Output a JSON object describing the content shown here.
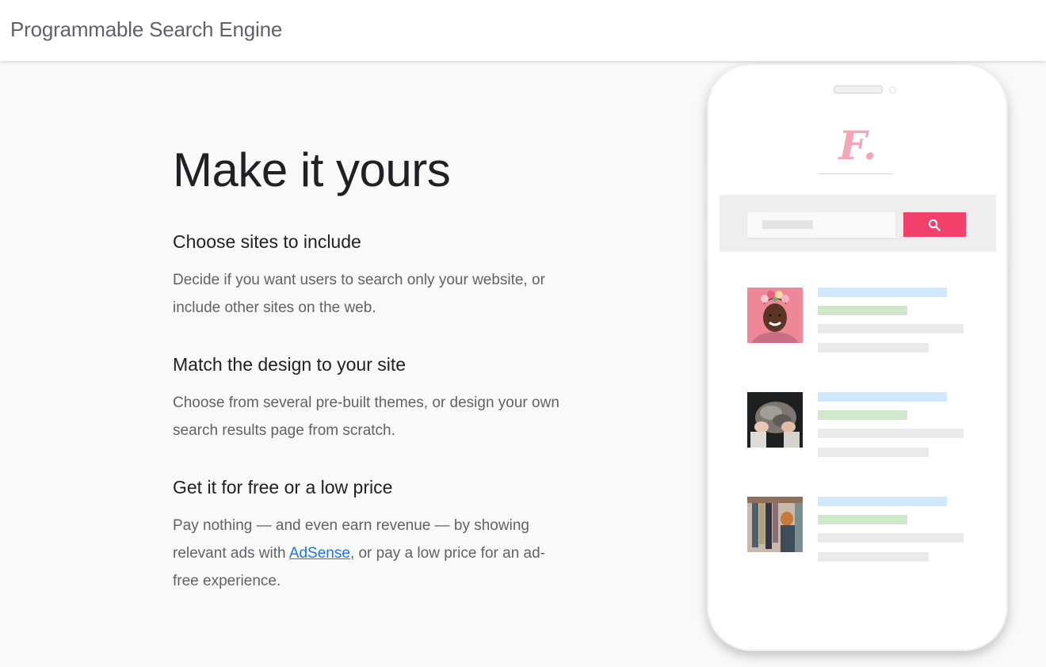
{
  "header": {
    "title": "Programmable Search Engine"
  },
  "main": {
    "headline": "Make it yours",
    "sections": [
      {
        "title": "Choose sites to include",
        "text": "Decide if you want users to search only your website, or include other sites on the web."
      },
      {
        "title": "Match the design to your site",
        "text": "Choose from several pre-built themes, or design your own search results page from scratch."
      },
      {
        "title": "Get it for free or a low price",
        "text_before_link": "Pay nothing — and even earn revenue — by showing relevant ads with ",
        "link_label": "AdSense",
        "text_after_link": ", or pay a low price for an ad-free experience."
      }
    ]
  },
  "phone": {
    "logo_text": "F.",
    "icons": {
      "search": "search-icon"
    },
    "colors": {
      "search_button": "#f2416b",
      "logo": "#f4a6b7",
      "result_title_bar": "#d2e8fb",
      "result_url_bar": "#d1e7cc",
      "result_text_bar": "#ebebeb"
    }
  }
}
